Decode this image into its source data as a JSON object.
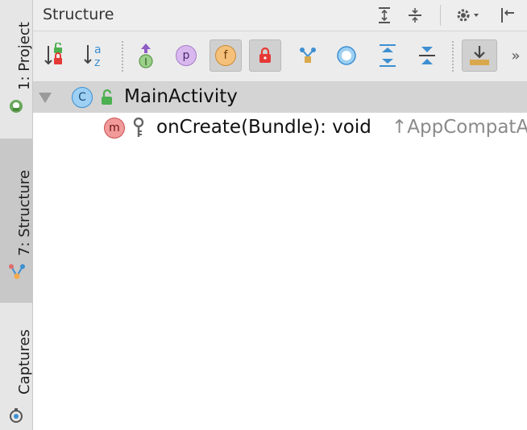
{
  "panel": {
    "title": "Structure"
  },
  "sidebar": {
    "tabs": [
      {
        "label": "1: Project"
      },
      {
        "label": "7: Structure"
      },
      {
        "label": "Captures"
      }
    ]
  },
  "tree": {
    "class_node": {
      "icon_letter": "C",
      "name": "MainActivity"
    },
    "method_node": {
      "icon_letter": "m",
      "signature": "onCreate(Bundle): void",
      "inherited": "↑AppCompatA"
    }
  },
  "toolbar": {
    "badges": {
      "inherited_letter": "I",
      "properties_letter": "p",
      "fields_letter": "f",
      "alpha_a": "a",
      "alpha_z": "z"
    },
    "overflow": "»"
  },
  "colors": {
    "accent_blue": "#3d8fd1",
    "method_red": "#e06c6c",
    "field_orange": "#f5a94d",
    "property_purple": "#c792e8"
  }
}
